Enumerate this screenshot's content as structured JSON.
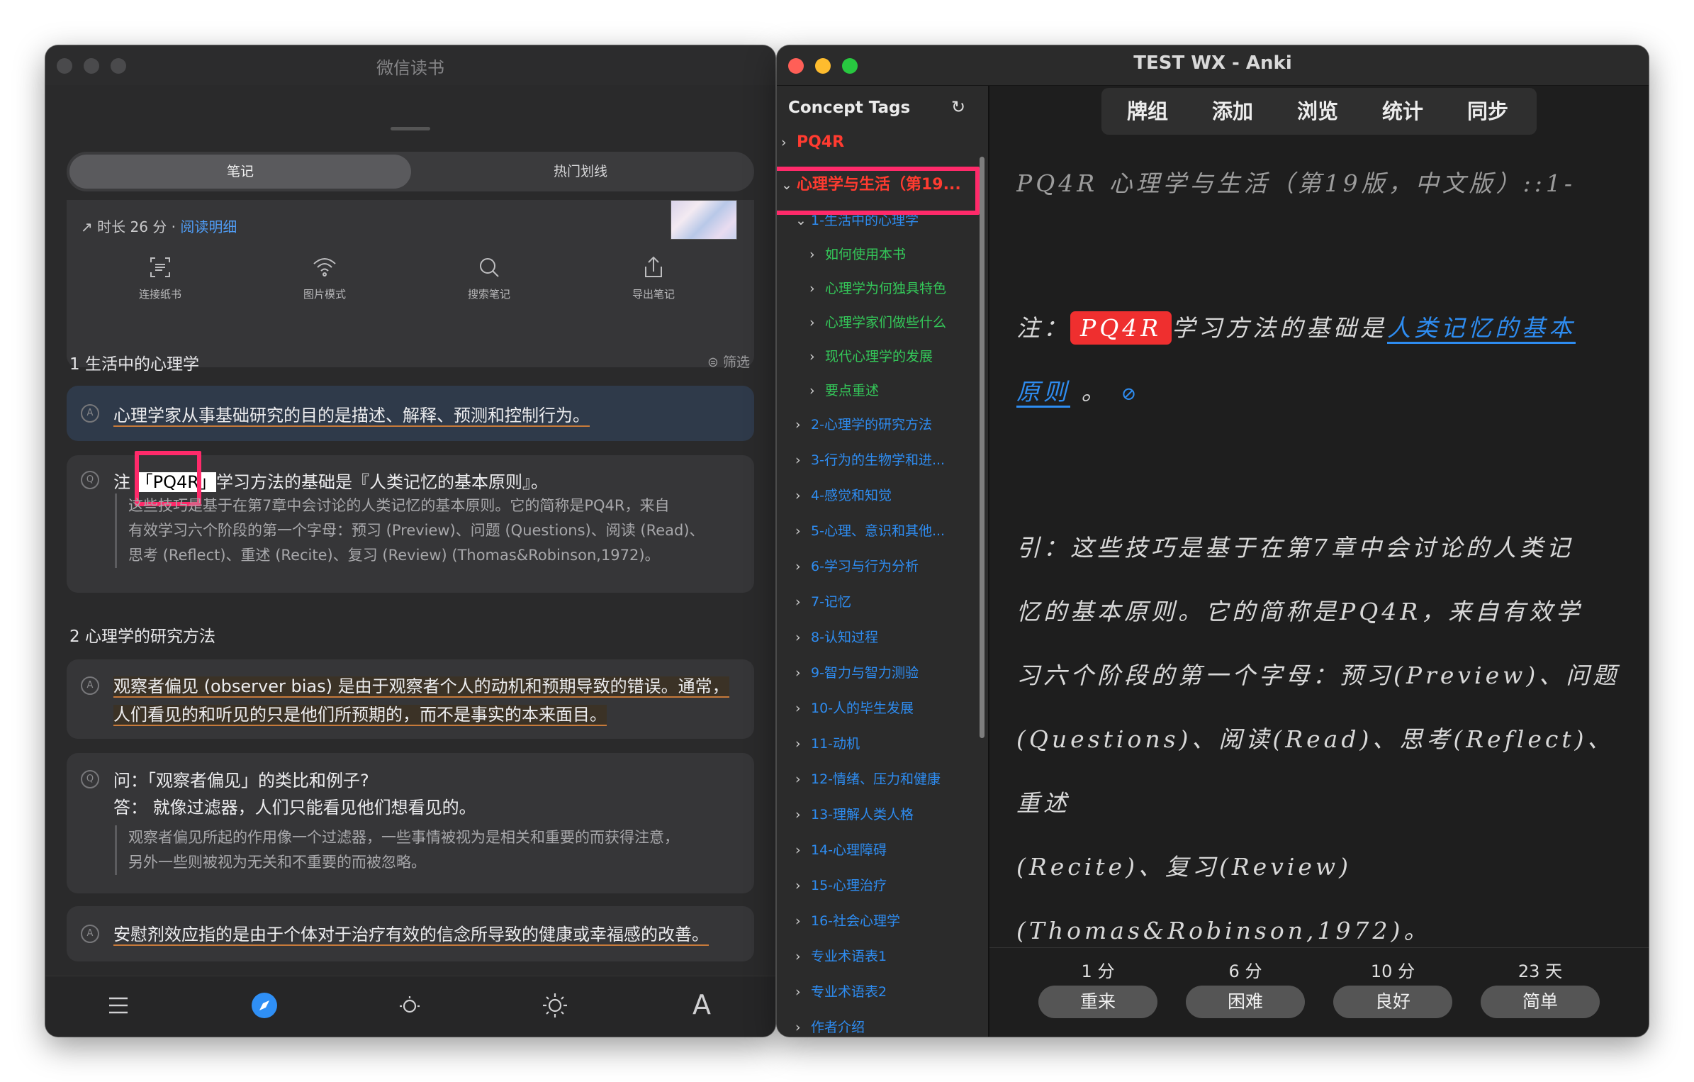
{
  "weread": {
    "title": "微信读书",
    "tabs": [
      "笔记",
      "热门划线"
    ],
    "stats": {
      "duration": "时长 26 分 · ",
      "detail_link": "阅读明细"
    },
    "tools": [
      "连接纸书",
      "图片模式",
      "搜索笔记",
      "导出笔记"
    ],
    "filter": "筛选",
    "section1": "1 生活中的心理学",
    "section2": "2 心理学的研究方法",
    "note1": "心理学家从事基础研究的目的是描述、解释、预测和控制行为。",
    "note2_prefix": "注",
    "note2_tag": "「PQ4R」",
    "note2_suffix": "学习方法的基础是『人类记忆的基本原则』。",
    "note2_quote": [
      "这些技巧是基于在第7章中会讨论的人类记忆的基本原则。它的简称是PQ4R，来自",
      "有效学习六个阶段的第一个字母：预习 (Preview)、问题 (Questions)、阅读 (Read)、",
      "思考 (Reflect)、重述 (Recite)、复习 (Review) (Thomas&Robinson,1972)。"
    ],
    "note3": [
      "观察者偏见 (observer bias) 是由于观察者个人的动机和预期导致的错误。通常，",
      "人们看见的和听见的只是他们所预期的，而不是事实的本来面目。"
    ],
    "note4_q": "问：「观察者偏见」的类比和例子?",
    "note4_a": "答： 就像过滤器，人们只能看见他们想看见的。",
    "note4_quote": [
      "观察者偏见所起的作用像一个过滤器，一些事情被视为是相关和重要的而获得注意，",
      "另外一些则被视为无关和不重要的而被忽略。"
    ],
    "note5": "安慰剂效应指的是由于个体对于治疗有效的信念所导致的健康或幸福感的改善。",
    "bottom_icons": [
      "menu-icon",
      "compass-icon",
      "brightness-low-icon",
      "brightness-high-icon",
      "font-icon"
    ]
  },
  "anki": {
    "title": "TEST WX - Anki",
    "sidebar_title": "Concept Tags",
    "tags": [
      {
        "label": "PQ4R",
        "color": "#ff3b30",
        "bold": true
      },
      {
        "label": "心理学与生活（第19...",
        "color": "#ff3b30",
        "bold": true
      },
      {
        "label": "1-生活中的心理学",
        "color": "#2e8cf0"
      },
      {
        "label": "如何使用本书",
        "color": "#34c759"
      },
      {
        "label": "心理学为何独具特色",
        "color": "#34c759"
      },
      {
        "label": "心理学家们做些什么",
        "color": "#34c759"
      },
      {
        "label": "现代心理学的发展",
        "color": "#34c759"
      },
      {
        "label": "要点重述",
        "color": "#34c759"
      },
      {
        "label": "2-心理学的研究方法",
        "color": "#2e8cf0"
      },
      {
        "label": "3-行为的生物学和进...",
        "color": "#2e8cf0"
      },
      {
        "label": "4-感觉和知觉",
        "color": "#2e8cf0"
      },
      {
        "label": "5-心理、意识和其他...",
        "color": "#2e8cf0"
      },
      {
        "label": "6-学习与行为分析",
        "color": "#2e8cf0"
      },
      {
        "label": "7-记忆",
        "color": "#2e8cf0"
      },
      {
        "label": "8-认知过程",
        "color": "#2e8cf0"
      },
      {
        "label": "9-智力与智力测验",
        "color": "#2e8cf0"
      },
      {
        "label": "10-人的毕生发展",
        "color": "#2e8cf0"
      },
      {
        "label": "11-动机",
        "color": "#2e8cf0"
      },
      {
        "label": "12-情绪、压力和健康",
        "color": "#2e8cf0"
      },
      {
        "label": "13-理解人类人格",
        "color": "#2e8cf0"
      },
      {
        "label": "14-心理障碍",
        "color": "#2e8cf0"
      },
      {
        "label": "15-心理治疗",
        "color": "#2e8cf0"
      },
      {
        "label": "16-社会心理学",
        "color": "#2e8cf0"
      },
      {
        "label": "专业术语表1",
        "color": "#2e8cf0"
      },
      {
        "label": "专业术语表2",
        "color": "#2e8cf0"
      },
      {
        "label": "作者介绍",
        "color": "#2e8cf0"
      }
    ],
    "toolbar": [
      "牌组",
      "添加",
      "浏览",
      "统计",
      "同步"
    ],
    "card_header": "PQ4R 心理学与生活（第19版，中文版）::1-",
    "card_note_prefix": "注：",
    "card_note_tag": "PQ4R",
    "card_note_mid": "学习方法的基础是",
    "card_link1": "人类记忆的基本",
    "card_link2": "原则",
    "card_note_end": " 。",
    "card_quote": [
      "引：这些技巧是基于在第7章中会讨论的人类记",
      "忆的基本原则。它的简称是PQ4R，来自有效学",
      "习六个阶段的第一个字母：预习(Preview)、问题",
      "(Questions)、阅读(Read)、思考(Reflect)、重述",
      "(Recite)、复习(Review)",
      "(Thomas&Robinson,1972)。"
    ],
    "ease": [
      {
        "time": "1 分",
        "label": "重来"
      },
      {
        "time": "6 分",
        "label": "困难"
      },
      {
        "time": "10 分",
        "label": "良好"
      },
      {
        "time": "23 天",
        "label": "简单"
      }
    ]
  },
  "colors": {
    "highlight_red": "#ff2a6a",
    "anki_blue": "#2e8cf0",
    "anki_green": "#34c759",
    "tag_red": "#ff3b30",
    "weread_accent": "#2f8ff5"
  }
}
